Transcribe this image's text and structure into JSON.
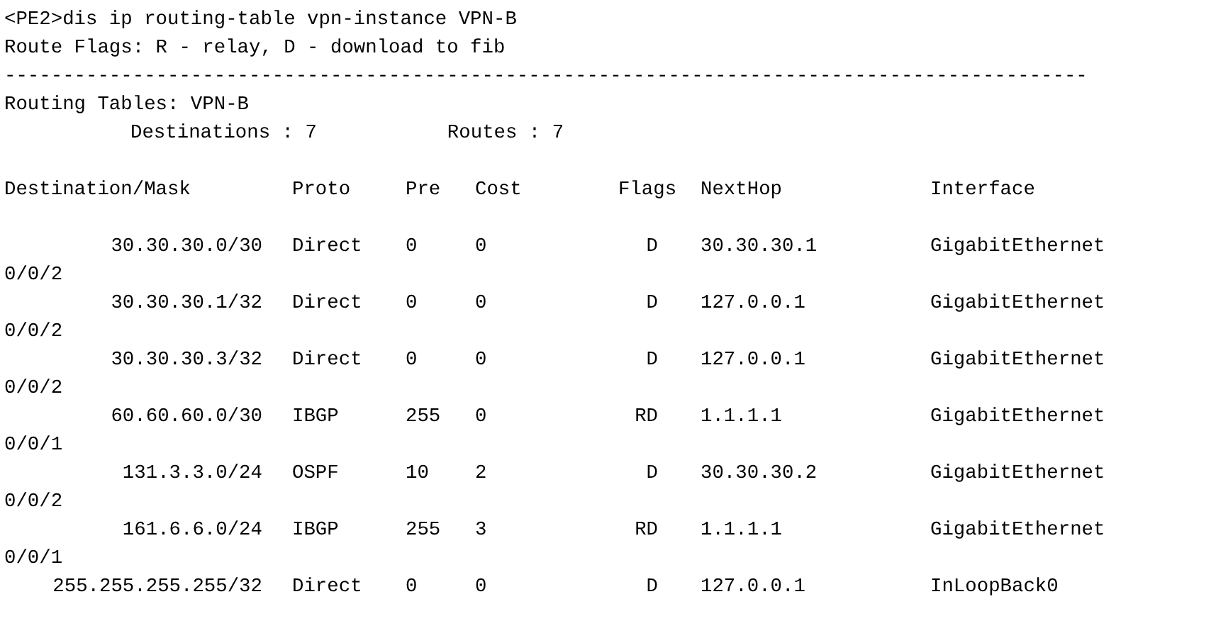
{
  "command": "<PE2>dis ip routing-table vpn-instance VPN-B",
  "legend": "Route Flags: R - relay, D - download to fib",
  "separator": "---------------------------------------------------------------------------------------------",
  "table_title": "Routing Tables: VPN-B",
  "summary": {
    "destinations": "Destinations : 7",
    "routes": "Routes : 7"
  },
  "columns": [
    "Destination/Mask",
    "Proto",
    "Pre",
    "Cost",
    "Flags",
    "NextHop",
    "Interface"
  ],
  "rows": [
    {
      "destination": "30.30.30.0/30",
      "proto": "Direct",
      "pre": "0",
      "cost": "0",
      "flags": "D",
      "nexthop": "30.30.30.1",
      "interface": "GigabitEthernet",
      "interface_wrap": "0/0/2"
    },
    {
      "destination": "30.30.30.1/32",
      "proto": "Direct",
      "pre": "0",
      "cost": "0",
      "flags": "D",
      "nexthop": "127.0.0.1",
      "interface": "GigabitEthernet",
      "interface_wrap": "0/0/2"
    },
    {
      "destination": "30.30.30.3/32",
      "proto": "Direct",
      "pre": "0",
      "cost": "0",
      "flags": "D",
      "nexthop": "127.0.0.1",
      "interface": "GigabitEthernet",
      "interface_wrap": "0/0/2"
    },
    {
      "destination": "60.60.60.0/30",
      "proto": "IBGP",
      "pre": "255",
      "cost": "0",
      "flags": "RD",
      "nexthop": "1.1.1.1",
      "interface": "GigabitEthernet",
      "interface_wrap": "0/0/1"
    },
    {
      "destination": "131.3.3.0/24",
      "proto": "OSPF",
      "pre": "10",
      "cost": "2",
      "flags": "D",
      "nexthop": "30.30.30.2",
      "interface": "GigabitEthernet",
      "interface_wrap": "0/0/2"
    },
    {
      "destination": "161.6.6.0/24",
      "proto": "IBGP",
      "pre": "255",
      "cost": "3",
      "flags": "RD",
      "nexthop": "1.1.1.1",
      "interface": "GigabitEthernet",
      "interface_wrap": "0/0/1"
    },
    {
      "destination": "255.255.255.255/32",
      "proto": "Direct",
      "pre": "0",
      "cost": "0",
      "flags": "D",
      "nexthop": "127.0.0.1",
      "interface": "InLoopBack0"
    }
  ]
}
